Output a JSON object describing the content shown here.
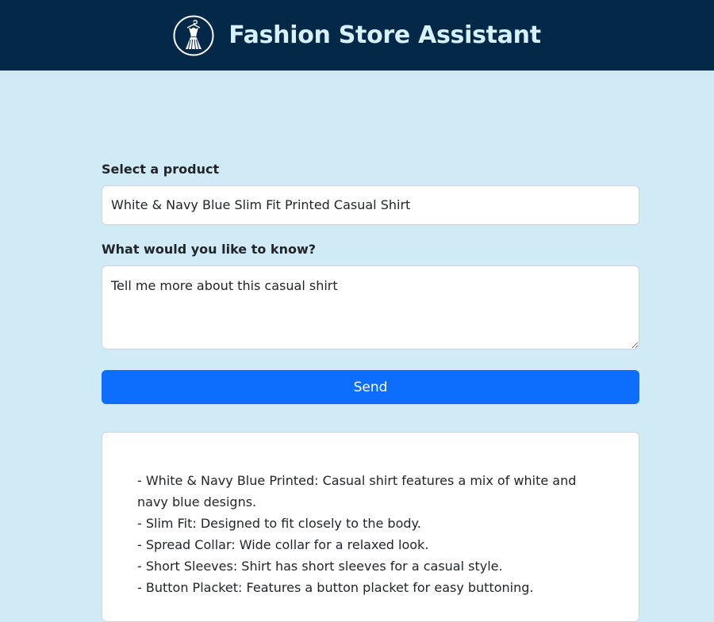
{
  "header": {
    "title": "Fashion Store Assistant",
    "logo_icon": "dress-hanger-icon"
  },
  "form": {
    "product_label": "Select a product",
    "product_value": "White & Navy Blue Slim Fit Printed Casual Shirt",
    "question_label": "What would you like to know?",
    "question_value": "Tell me more about this casual shirt",
    "send_label": "Send"
  },
  "response": {
    "lines": [
      "- White & Navy Blue Printed: Casual shirt features a mix of white and",
      "navy blue designs.",
      "- Slim Fit: Designed to fit closely to the body.",
      "- Spread Collar: Wide collar for a relaxed look.",
      "- Short Sleeves: Shirt has short sleeves for a casual style.",
      "- Button Placket: Features a button placket for easy buttoning."
    ]
  },
  "colors": {
    "header_bg": "#032848",
    "title_color": "#d6f1fb",
    "page_bg": "#d0ebf6",
    "accent": "#0d6efd"
  }
}
